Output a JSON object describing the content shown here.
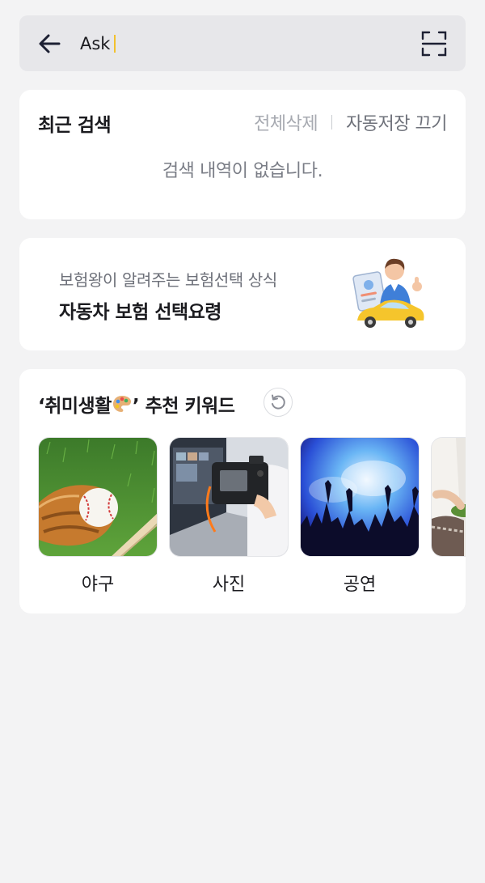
{
  "search": {
    "value": "Ask"
  },
  "recent": {
    "title": "최근 검색",
    "clear_all": "전체삭제",
    "autosave_off": "자동저장 끄기",
    "empty_message": "검색 내역이 없습니다."
  },
  "banner": {
    "subtitle": "보험왕이 알려주는 보험선택 상식",
    "title": "자동차 보험 선택요령"
  },
  "hobby": {
    "title_prefix": "‘취미생활",
    "title_suffix": "’ 추천 키워드",
    "keywords": [
      {
        "label": "야구",
        "icon": "baseball-glove"
      },
      {
        "label": "사진",
        "icon": "camera"
      },
      {
        "label": "공연",
        "icon": "concert-crowd"
      },
      {
        "label": "",
        "icon": "cooking"
      }
    ]
  },
  "colors": {
    "caret": "#f2c12e",
    "background": "#f3f3f4",
    "card": "#ffffff"
  }
}
